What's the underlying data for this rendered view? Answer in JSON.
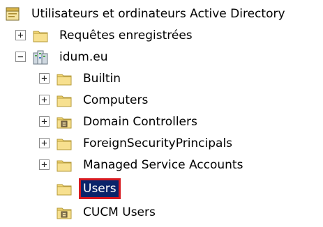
{
  "tree": {
    "root": {
      "label": "Utilisateurs et ordinateurs Active Directory",
      "icon": "ad-console-icon"
    },
    "saved_queries": {
      "label": "Requêtes enregistrées",
      "expander": "+",
      "icon": "folder-icon"
    },
    "domain": {
      "label": "idum.eu",
      "expander": "−",
      "icon": "domain-icon"
    },
    "children": [
      {
        "label": "Builtin",
        "expander": "+",
        "icon": "folder-icon"
      },
      {
        "label": "Computers",
        "expander": "+",
        "icon": "folder-icon"
      },
      {
        "label": "Domain Controllers",
        "expander": "+",
        "icon": "ou-folder-icon"
      },
      {
        "label": "ForeignSecurityPrincipals",
        "expander": "+",
        "icon": "folder-icon"
      },
      {
        "label": "Managed Service Accounts",
        "expander": "+",
        "icon": "folder-icon"
      },
      {
        "label": "Users",
        "expander": "",
        "icon": "folder-icon",
        "selected": true
      },
      {
        "label": "CUCM Users",
        "expander": "",
        "icon": "ou-folder-icon"
      }
    ]
  },
  "colors": {
    "selection_bg": "#0a246a",
    "selection_outline": "#d71920",
    "folder": "#f3d774"
  }
}
